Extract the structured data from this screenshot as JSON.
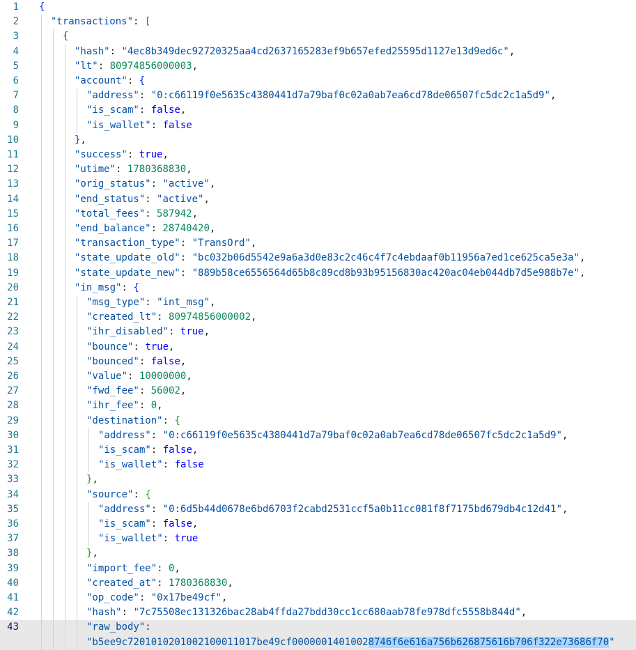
{
  "editor": {
    "current_line": 43,
    "lines": [
      {
        "n": "1",
        "indent": 0,
        "code": "{"
      },
      {
        "n": "2",
        "indent": 1,
        "code": "\"transactions\": ["
      },
      {
        "n": "3",
        "indent": 2,
        "code": "{"
      },
      {
        "n": "4",
        "indent": 3,
        "code": "\"hash\": \"4ec8b349dec92720325aa4cd2637165283ef9b657efed25595d1127e13d9ed6c\","
      },
      {
        "n": "5",
        "indent": 3,
        "code": "\"lt\": 80974856000003,"
      },
      {
        "n": "6",
        "indent": 3,
        "code": "\"account\": {"
      },
      {
        "n": "7",
        "indent": 4,
        "code": "\"address\": \"0:c66119f0e5635c4380441d7a79baf0c02a0ab7ea6cd78de06507fc5dc2c1a5d9\","
      },
      {
        "n": "8",
        "indent": 4,
        "code": "\"is_scam\": false,"
      },
      {
        "n": "9",
        "indent": 4,
        "code": "\"is_wallet\": false"
      },
      {
        "n": "10",
        "indent": 3,
        "code": "},"
      },
      {
        "n": "11",
        "indent": 3,
        "code": "\"success\": true,"
      },
      {
        "n": "12",
        "indent": 3,
        "code": "\"utime\": 1780368830,"
      },
      {
        "n": "13",
        "indent": 3,
        "code": "\"orig_status\": \"active\","
      },
      {
        "n": "14",
        "indent": 3,
        "code": "\"end_status\": \"active\","
      },
      {
        "n": "15",
        "indent": 3,
        "code": "\"total_fees\": 587942,"
      },
      {
        "n": "16",
        "indent": 3,
        "code": "\"end_balance\": 28740420,"
      },
      {
        "n": "17",
        "indent": 3,
        "code": "\"transaction_type\": \"TransOrd\","
      },
      {
        "n": "18",
        "indent": 3,
        "code": "\"state_update_old\": \"bc032b06d5542e9a6a3d0e83c2c46c4f7c4ebdaaf0b11956a7ed1ce625ca5e3a\","
      },
      {
        "n": "19",
        "indent": 3,
        "code": "\"state_update_new\": \"889b58ce6556564d65b8c89cd8b93b95156830ac420ac04eb044db7d5e988b7e\","
      },
      {
        "n": "20",
        "indent": 3,
        "code": "\"in_msg\": {"
      },
      {
        "n": "21",
        "indent": 4,
        "code": "\"msg_type\": \"int_msg\","
      },
      {
        "n": "22",
        "indent": 4,
        "code": "\"created_lt\": 80974856000002,"
      },
      {
        "n": "23",
        "indent": 4,
        "code": "\"ihr_disabled\": true,"
      },
      {
        "n": "24",
        "indent": 4,
        "code": "\"bounce\": true,"
      },
      {
        "n": "25",
        "indent": 4,
        "code": "\"bounced\": false,"
      },
      {
        "n": "26",
        "indent": 4,
        "code": "\"value\": 10000000,"
      },
      {
        "n": "27",
        "indent": 4,
        "code": "\"fwd_fee\": 56002,"
      },
      {
        "n": "28",
        "indent": 4,
        "code": "\"ihr_fee\": 0,"
      },
      {
        "n": "29",
        "indent": 4,
        "code": "\"destination\": {"
      },
      {
        "n": "30",
        "indent": 5,
        "code": "\"address\": \"0:c66119f0e5635c4380441d7a79baf0c02a0ab7ea6cd78de06507fc5dc2c1a5d9\","
      },
      {
        "n": "31",
        "indent": 5,
        "code": "\"is_scam\": false,"
      },
      {
        "n": "32",
        "indent": 5,
        "code": "\"is_wallet\": false"
      },
      {
        "n": "33",
        "indent": 4,
        "code": "},"
      },
      {
        "n": "34",
        "indent": 4,
        "code": "\"source\": {"
      },
      {
        "n": "35",
        "indent": 5,
        "code": "\"address\": \"0:6d5b44d0678e6bd6703f2cabd2531ccf5a0b11cc081f8f7175bd679db4c12d41\","
      },
      {
        "n": "36",
        "indent": 5,
        "code": "\"is_scam\": false,"
      },
      {
        "n": "37",
        "indent": 5,
        "code": "\"is_wallet\": true"
      },
      {
        "n": "38",
        "indent": 4,
        "code": "},"
      },
      {
        "n": "39",
        "indent": 4,
        "code": "\"import_fee\": 0,"
      },
      {
        "n": "40",
        "indent": 4,
        "code": "\"created_at\": 1780368830,"
      },
      {
        "n": "41",
        "indent": 4,
        "code": "\"op_code\": \"0x17be49cf\","
      },
      {
        "n": "42",
        "indent": 4,
        "code": "\"hash\": \"7c75508ec131326bac28ab4ffda27bdd30cc1cc680aab78fe978dfc5558b844d\","
      },
      {
        "n": "43",
        "indent": 4,
        "code": "\"raw_body\":"
      },
      {
        "n": "",
        "indent": 4,
        "code": "\"b5ee9c72010102010021000110 17be49cf000000140100287 46f6e616a756b626875616b706f322e73686f70\"",
        "wrapped": true
      }
    ],
    "wrapped_raw_body": {
      "prefix": "\"b5ee9c7201010201002100011017be49cf0000001401002",
      "selected": "8746f6e616a756b626875616b706f322e73686f70",
      "suffix": "\""
    }
  },
  "colors": {
    "keys": "#0451a5",
    "numbers": "#098658",
    "booleans": "#0000ff",
    "line_numbers": "#237893",
    "current_line_bg": "#e8e8e8",
    "selection": "#add6ff"
  }
}
